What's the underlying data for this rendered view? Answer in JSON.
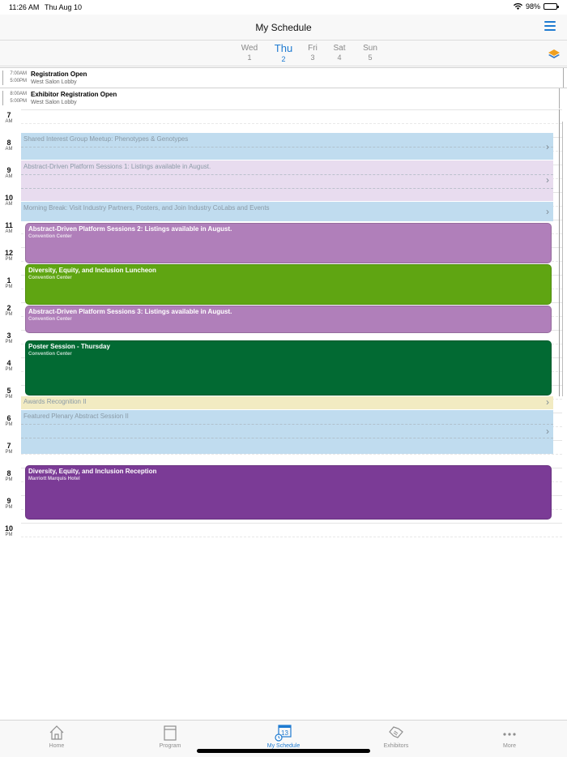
{
  "status_bar": {
    "time": "11:26 AM",
    "date": "Thu Aug 10",
    "battery": "98%"
  },
  "header": {
    "title": "My Schedule"
  },
  "days": [
    {
      "name": "Wed",
      "date": "1",
      "active": false
    },
    {
      "name": "Thu",
      "date": "2",
      "active": true
    },
    {
      "name": "Fri",
      "date": "3",
      "active": false
    },
    {
      "name": "Sat",
      "date": "4",
      "active": false
    },
    {
      "name": "Sun",
      "date": "5",
      "active": false
    }
  ],
  "all_day": [
    {
      "start": "7:00AM",
      "end": "5:00PM",
      "title": "Registration Open",
      "location": "West Salon Lobby"
    },
    {
      "start": "8:00AM",
      "end": "5:00PM",
      "title": "Exhibitor Registration Open",
      "location": "West Salon Lobby"
    }
  ],
  "hours": [
    {
      "num": "7",
      "ap": "AM"
    },
    {
      "num": "8",
      "ap": "AM"
    },
    {
      "num": "9",
      "ap": "AM"
    },
    {
      "num": "10",
      "ap": "AM"
    },
    {
      "num": "11",
      "ap": "AM"
    },
    {
      "num": "12",
      "ap": "PM"
    },
    {
      "num": "1",
      "ap": "PM"
    },
    {
      "num": "2",
      "ap": "PM"
    },
    {
      "num": "3",
      "ap": "PM"
    },
    {
      "num": "4",
      "ap": "PM"
    },
    {
      "num": "5",
      "ap": "PM"
    },
    {
      "num": "6",
      "ap": "PM"
    },
    {
      "num": "7",
      "ap": "PM"
    },
    {
      "num": "8",
      "ap": "PM"
    },
    {
      "num": "9",
      "ap": "PM"
    },
    {
      "num": "10",
      "ap": "PM"
    }
  ],
  "faded_events": [
    {
      "title": "Shared Interest Group Meetup: Phenotypes & Genotypes",
      "color": "#c0dcef"
    },
    {
      "title": "Abstract-Driven Platform Sessions 1: Listings available in August.",
      "color": "#e8dcef"
    },
    {
      "title": "Morning Break: Visit Industry Partners, Posters, and Join Industry CoLabs and Events",
      "color": "#c0dcef"
    },
    {
      "title": "Awards Recognition II",
      "color": "#f2ebc2"
    },
    {
      "title": "Featured Plenary Abstract Session II",
      "color": "#c0dcef"
    }
  ],
  "events": [
    {
      "title": "Abstract-Driven Platform Sessions 2: Listings available in August.",
      "location": "Convention Center",
      "color": "#b07fba"
    },
    {
      "title": "Diversity, Equity, and Inclusion Luncheon",
      "location": "Convention Center",
      "color": "#5fa512"
    },
    {
      "title": "Abstract-Driven Platform Sessions 3: Listings available in August.",
      "location": "Convention Center",
      "color": "#b07fba"
    },
    {
      "title": "Poster Session - Thursday",
      "location": "Convention Center",
      "color": "#026a33"
    },
    {
      "title": "Diversity, Equity, and Inclusion Reception",
      "location": "Marriott Marquis Hotel",
      "color": "#7b3b96"
    }
  ],
  "tabs": [
    {
      "label": "Home",
      "icon": "home-icon",
      "active": false
    },
    {
      "label": "Program",
      "icon": "program-icon",
      "active": false
    },
    {
      "label": "My Schedule",
      "icon": "calendar-icon",
      "active": true
    },
    {
      "label": "Exhibitors",
      "icon": "handshake-icon",
      "active": false
    },
    {
      "label": "More",
      "icon": "more-icon",
      "active": false
    }
  ],
  "accent": "#1f7bd1"
}
